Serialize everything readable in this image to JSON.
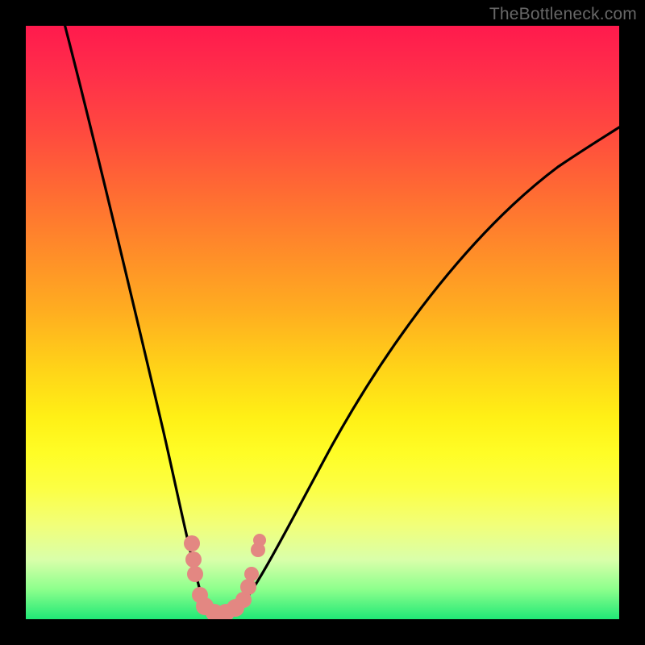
{
  "watermark": "TheBottleneck.com",
  "chart_data": {
    "type": "line",
    "title": "",
    "xlabel": "",
    "ylabel": "",
    "xlim": [
      0,
      100
    ],
    "ylim": [
      0,
      100
    ],
    "background_gradient": {
      "top": "#ff1a4d",
      "mid": "#fff016",
      "bottom": "#20e876"
    },
    "series": [
      {
        "name": "bottleneck-curve",
        "color": "#000000",
        "x": [
          6,
          10,
          15,
          20,
          24,
          27,
          29,
          31,
          33,
          36,
          40,
          45,
          50,
          60,
          70,
          80,
          90,
          100
        ],
        "y": [
          100,
          84,
          66,
          48,
          32,
          18,
          8,
          2,
          2,
          8,
          18,
          30,
          40,
          56,
          67,
          76,
          82,
          87
        ]
      },
      {
        "name": "data-points",
        "color": "#e38782",
        "type": "scatter",
        "x": [
          27.0,
          27.5,
          28.5,
          29.5,
          30.5,
          31.5,
          32.5,
          33.5,
          34.5,
          35.5,
          36.0
        ],
        "y": [
          14,
          9,
          3,
          1,
          1,
          1,
          1,
          2,
          4,
          8,
          13
        ]
      }
    ],
    "notch": {
      "x": 31,
      "depth_y": 0
    }
  }
}
